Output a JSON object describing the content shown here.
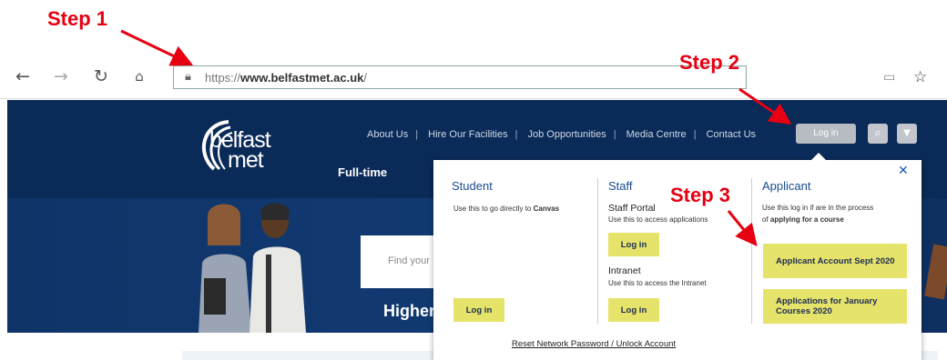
{
  "annotations": {
    "step1": "Step 1",
    "step2": "Step 2",
    "step3": "Step 3",
    "arrow_color": "#e60012"
  },
  "browser": {
    "back_icon": "back-arrow-icon",
    "forward_icon": "forward-arrow-icon",
    "refresh_icon": "refresh-icon",
    "home_icon": "home-icon",
    "url_prefix": "https://",
    "url_domain": "www.belfastmet.ac.uk",
    "url_suffix": "/",
    "reader_icon": "reading-view-icon",
    "favorite_icon": "star-icon"
  },
  "site": {
    "logo_line1": "belfast",
    "logo_line2": "met",
    "nav": [
      "About Us",
      "Hire Our Facilities",
      "Job Opportunities",
      "Media Centre",
      "Contact Us"
    ],
    "login_label": "Log in",
    "search_icon": "search-icon",
    "menu_icon": "chevron-down-icon",
    "fulltime": "Full-time",
    "search_placeholder": "Find your",
    "hero_heading": "Higher",
    "brand_color": "#0a2a57"
  },
  "dropdown": {
    "close": "✕",
    "student": {
      "heading": "Student",
      "text_prefix": "Use this to go directly to ",
      "text_bold": "Canvas",
      "button": "Log in"
    },
    "staff": {
      "heading": "Staff",
      "portal_heading": "Staff Portal",
      "portal_text": "Use this to access applications",
      "portal_button": "Log in",
      "intranet_heading": "Intranet",
      "intranet_text": "Use this to access the Intranet",
      "intranet_button": "Log in"
    },
    "applicant": {
      "heading": "Applicant",
      "text_line1": "Use this log in if are in the process",
      "text_prefix": "of ",
      "text_bold": "applying for a course",
      "button1": "Applicant Account Sept 2020",
      "button2": "Applications for January Courses 2020"
    },
    "reset_link": "Reset Network Password / Unlock Account",
    "button_color": "#e6e36a"
  }
}
